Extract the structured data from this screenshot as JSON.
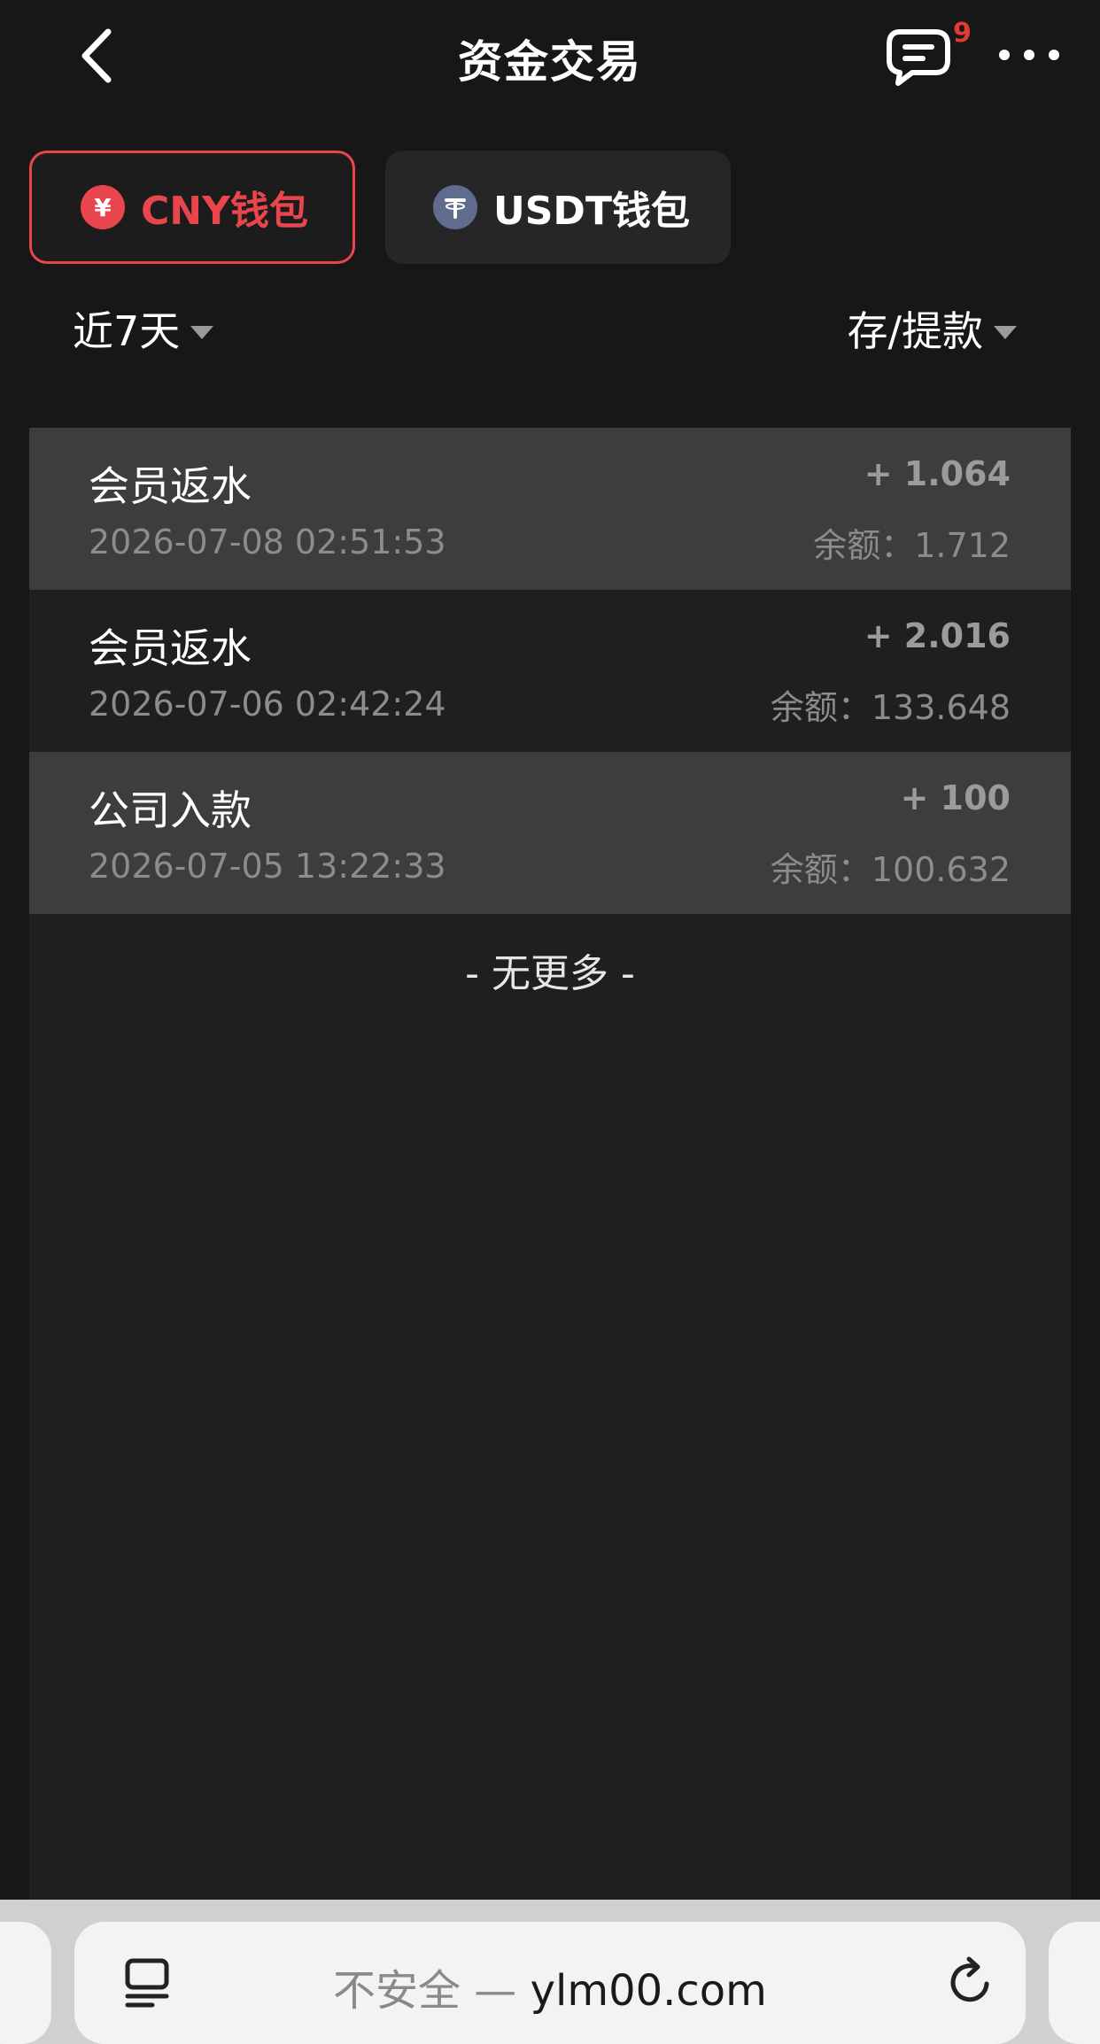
{
  "header": {
    "title": "资金交易",
    "message_badge": "9"
  },
  "wallets": [
    {
      "label": "CNY钱包",
      "icon_glyph": "¥",
      "active": true
    },
    {
      "label": "USDT钱包",
      "icon_glyph": "T",
      "active": false
    }
  ],
  "filters": {
    "date_range": "近7天",
    "type": "存/提款"
  },
  "transactions": [
    {
      "title": "会员返水",
      "time": "2026-07-08 02:51:53",
      "amount": "+ 1.064",
      "balance": "余额：1.712"
    },
    {
      "title": "会员返水",
      "time": "2026-07-06 02:42:24",
      "amount": "+ 2.016",
      "balance": "余额：133.648"
    },
    {
      "title": "公司入款",
      "time": "2026-07-05 13:22:33",
      "amount": "+ 100",
      "balance": "余额：100.632"
    }
  ],
  "list_footer": "- 无更多 -",
  "browser": {
    "insecure_label": "不安全 — ",
    "domain": "ylm00.com"
  },
  "colors": {
    "accent": "#e8454c",
    "background": "#171717",
    "panel": "#1f1f1f",
    "row_shaded": "#3d3d3d",
    "usdt_icon": "#5f6c8e"
  }
}
